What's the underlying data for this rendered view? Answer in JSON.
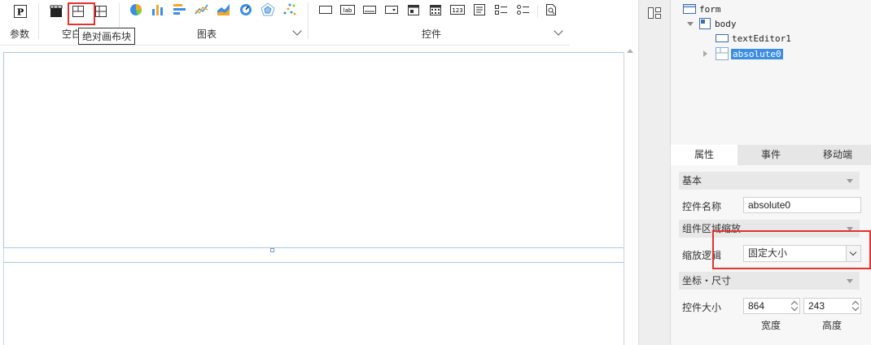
{
  "toolbar": {
    "param_label": "参数",
    "param_icon_text": "P",
    "blank_label": "空白",
    "chart_label": "图表",
    "control_label": "控件",
    "tooltip": "绝对画布块",
    "control_icon_texts": [
      "lab",
      "123"
    ],
    "icons": {
      "param": "param-p-icon",
      "blank": [
        "clapper-icon",
        "absolute-canvas-icon",
        "grid-layout-icon"
      ],
      "chart": [
        "pie-chart-icon",
        "bar-chart-icon",
        "horizontal-bar-icon",
        "line-chart-icon",
        "area-chart-icon",
        "gauge-chart-icon",
        "radar-chart-icon",
        "scatter-chart-icon"
      ],
      "control": [
        "button-icon",
        "label-icon",
        "text-field-icon",
        "dropdown-icon",
        "date-icon",
        "calendar-icon",
        "number-icon",
        "textarea-icon",
        "checkbox-group-icon",
        "radio-group-icon",
        "query-icon"
      ]
    }
  },
  "tree": {
    "root": "form",
    "body": "body",
    "child1": "textEditor1",
    "child2": "absolute0"
  },
  "tabs": [
    "属性",
    "事件",
    "移动端"
  ],
  "props": {
    "basic_section": "基本",
    "name_label": "控件名称",
    "name_value": "absolute0",
    "scale_section": "组件区域缩放",
    "scale_label": "缩放逻辑",
    "scale_value": "固定大小",
    "coord_section": "坐标・尺寸",
    "size_label": "控件大小",
    "width_value": "864",
    "height_value": "243",
    "width_caption": "宽度",
    "height_caption": "高度"
  },
  "colors": {
    "highlight": "#e5312f",
    "selection": "#3c8ee3",
    "canvas_border": "#a9c6e3"
  }
}
